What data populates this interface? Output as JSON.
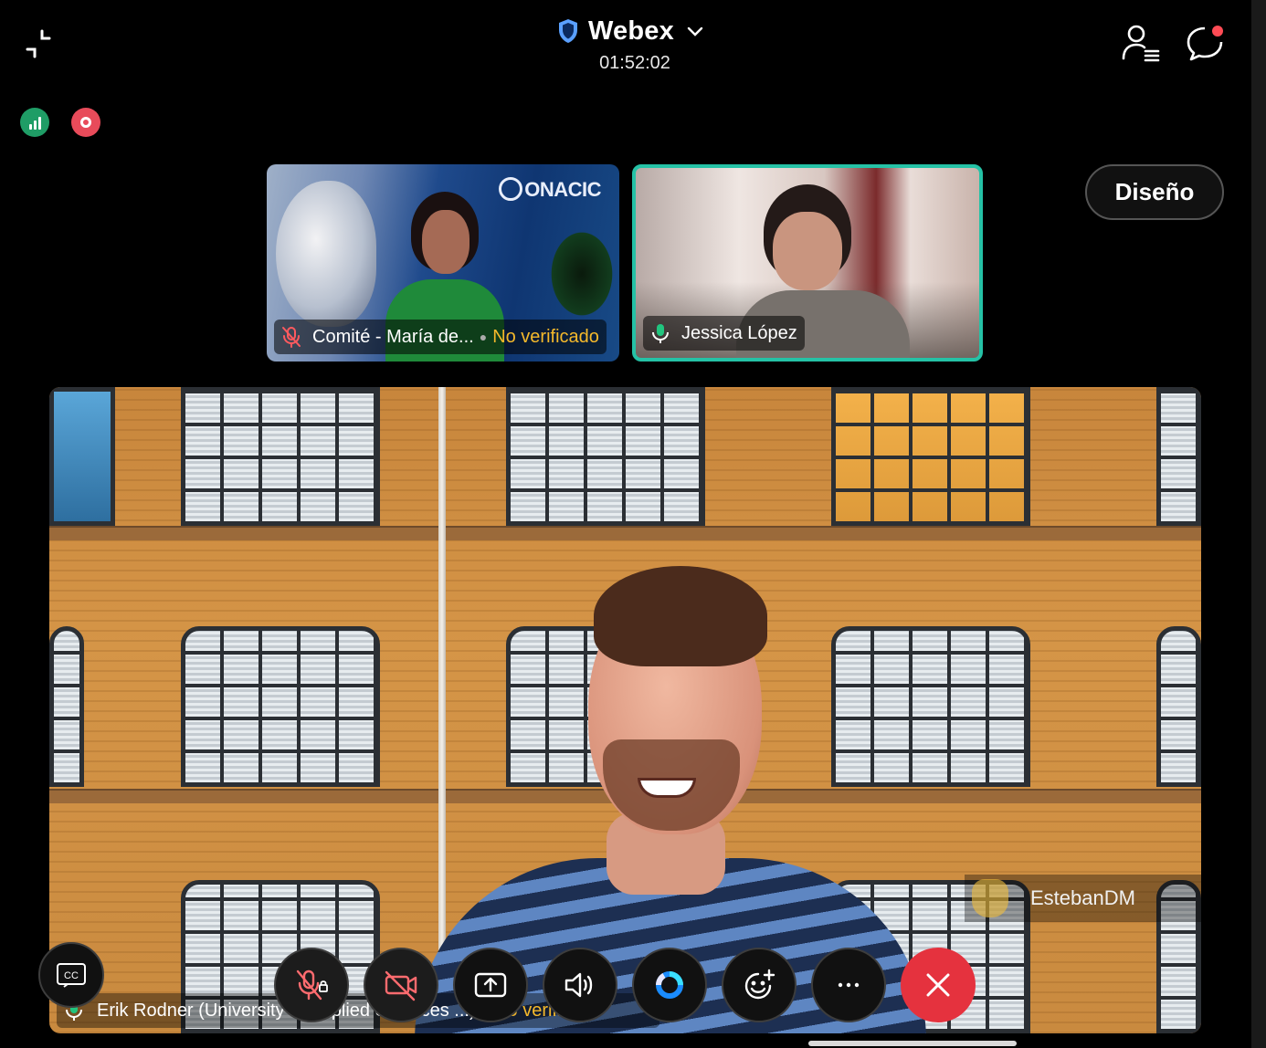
{
  "header": {
    "app_title": "Webex",
    "timer": "01:52:02",
    "layout_button": "Diseño"
  },
  "thumbnails": [
    {
      "name": "Comité - María de...",
      "status": "No verificado",
      "logo_text": "ONACIC",
      "muted": true,
      "active_speaker": false
    },
    {
      "name": "Jessica López",
      "status": "",
      "muted": false,
      "active_speaker": true
    }
  ],
  "stage": {
    "speaker_name": "Erik Rodner (University of Applied Sciences ...)",
    "speaker_status": "No verificado",
    "raised_hand_name": "EstebanDM"
  },
  "controls": {
    "cc": "CC",
    "items": [
      "captions",
      "mute-locked",
      "stop-video",
      "share",
      "audio",
      "ai-assistant",
      "reactions",
      "more",
      "leave"
    ]
  },
  "colors": {
    "accent_active": "#25c2a6",
    "leave": "#e5323e",
    "unverified": "#f5b92b",
    "signal": "#1f9d66",
    "recording": "#e84b5a"
  }
}
